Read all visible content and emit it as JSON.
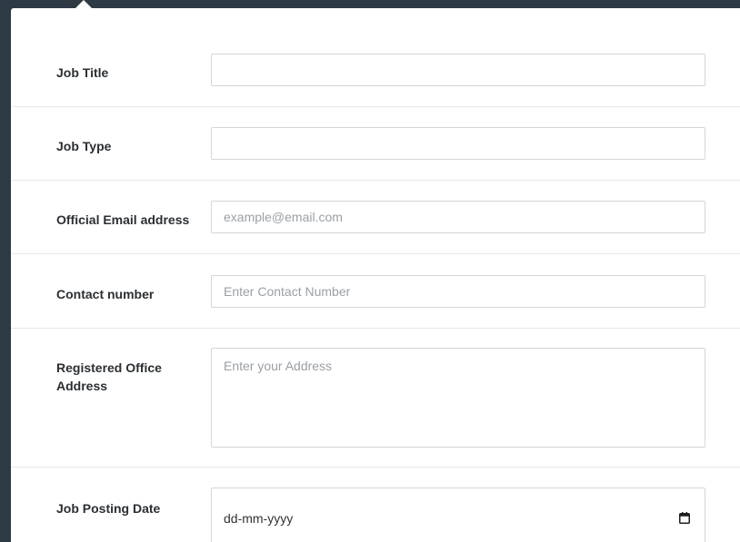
{
  "form": {
    "job_title": {
      "label": "Job Title",
      "value": "",
      "placeholder": ""
    },
    "job_type": {
      "label": "Job Type",
      "value": "",
      "placeholder": ""
    },
    "email": {
      "label": "Official Email address",
      "value": "",
      "placeholder": "example@email.com"
    },
    "contact": {
      "label": "Contact number",
      "value": "",
      "placeholder": "Enter Contact Number"
    },
    "address": {
      "label": "Registered Office Address",
      "value": "",
      "placeholder": "Enter your Address"
    },
    "posting_date": {
      "label": "Job Posting Date",
      "display": "dd-mm-yyyy",
      "icon": "calendar-icon"
    }
  },
  "colors": {
    "backdrop": "#2d3a44",
    "panel": "#ffffff",
    "divider": "#e6e8ea",
    "input_border": "#d2d6da",
    "label_text": "#2b2f33",
    "placeholder_text": "#9aa0a6"
  }
}
